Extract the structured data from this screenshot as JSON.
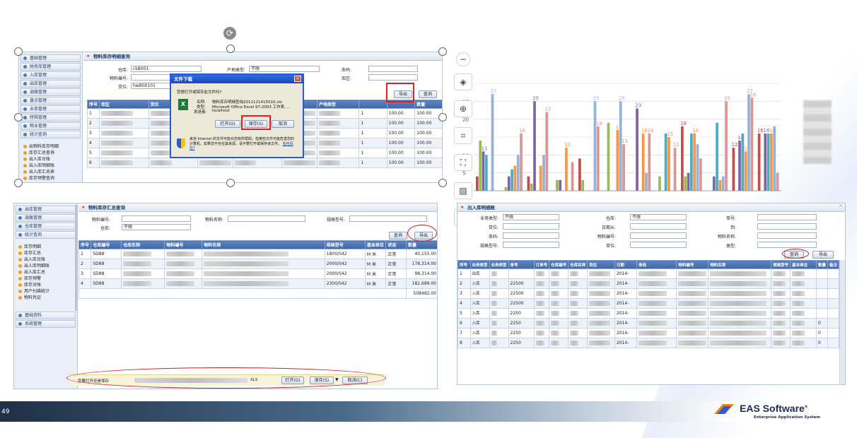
{
  "page_number": "49",
  "brand": {
    "name": "EAS Software",
    "reg": "®",
    "tagline": "Enterprise Application System"
  },
  "panel1": {
    "title": "物料库存明细查询",
    "menu": [
      "基础管理",
      "财务库管理",
      "入库管理",
      "出库管理",
      "调拨管理",
      "盘点管理",
      "业务管理",
      "特殊管理",
      "物业管理",
      "统计查询"
    ],
    "submenu": [
      "出物料库存明细",
      "库存汇总查询",
      "出入库台账",
      "出入库明细账",
      "出入库汇总表",
      "库存预警查询"
    ],
    "labels": {
      "warehouse": "仓库:",
      "material_no": "物料编号:",
      "location": "货位:",
      "product_type": "产地类型:",
      "barcode": "条码:",
      "zone": "库区:"
    },
    "values": {
      "warehouse": "ckB001",
      "location": "hwB00101",
      "product_type": "不限"
    },
    "btn_export": "导出",
    "btn_query": "查询",
    "columns": [
      "序号",
      "库区",
      "货位",
      "",
      "",
      "",
      "产地类型",
      "",
      "",
      "数量"
    ],
    "rows": [
      {
        "n": "1",
        "qty": "1",
        "amt": "100.00",
        "amt2": "100.00"
      },
      {
        "n": "2",
        "qty": "1",
        "amt": "100.00",
        "amt2": "100.00"
      },
      {
        "n": "3",
        "qty": "1",
        "amt": "100.00",
        "amt2": "100.00"
      },
      {
        "n": "4",
        "qty": "1",
        "amt": "100.00",
        "amt2": "100.00"
      },
      {
        "n": "5",
        "qty": "1",
        "amt": "100.00",
        "amt2": "100.00"
      },
      {
        "n": "6",
        "qty": "1",
        "amt": "100.00",
        "amt2": "100.00"
      }
    ],
    "cell_frag": "101"
  },
  "dialog": {
    "title": "文件下载",
    "question": "您想打开或保存此文件吗?",
    "name_label": "名称:",
    "name_value": "物料库存明细查询2011121415010.xls",
    "type_label": "类型:",
    "type_value": "Microsoft Office Excel 97-2003 工作表, ...",
    "from_label": "发送者:",
    "from_value": "localhost",
    "btn_open": "打开(O)",
    "btn_save": "保存(S)",
    "btn_cancel": "取消",
    "warning": "来自 Internet 的文件可能对您有所帮助，但某些文件可能危害您的计算机。如果您不信任其来源，请不要打开或保存该文件。",
    "risk_link": "有何风险?"
  },
  "panel2": {
    "title": "物料库存汇总查询",
    "menu_top": [
      "出库管理",
      "调拨管理",
      "仓库管理",
      "统计查询"
    ],
    "submenu": [
      "库存明细",
      "库存汇总",
      "出入库台账",
      "出入库明细账",
      "出入库汇总",
      "库存预警",
      "库存对账",
      "用户扫描统计",
      "物料凭证"
    ],
    "menu_bottom": [
      "基础资料",
      "系统管理"
    ],
    "labels": {
      "material_no": "物料编号:",
      "material_name": "物料名称:",
      "spec": "规格型号:",
      "warehouse": "仓库:"
    },
    "values": {
      "warehouse": "不限"
    },
    "btn_query": "查询",
    "btn_export": "导出",
    "columns": [
      "序号",
      "仓库编号",
      "仓库名称",
      "物料编号",
      "物料名称",
      "规格型号",
      "基本单位",
      "状态",
      "数量"
    ],
    "rows": [
      {
        "n": "1",
        "wh": "SD88",
        "spec": "1800/S42",
        "unit": "M 米",
        "status": "正常",
        "qty": "40,155.00"
      },
      {
        "n": "2",
        "wh": "SD88",
        "spec": "2000/S42",
        "unit": "M 米",
        "status": "正常",
        "qty": "178,314.00"
      },
      {
        "n": "3",
        "wh": "SD88",
        "spec": "2000/S42",
        "unit": "M 米",
        "status": "正常",
        "qty": "98,314.00"
      },
      {
        "n": "4",
        "wh": "SD88",
        "spec": "2300/S42",
        "unit": "M 米",
        "status": "正常",
        "qty": "182,689.00"
      }
    ],
    "total": "508482.00",
    "notify_text": "您要打开还是保存",
    "notify_frag": "XLS",
    "btn_open": "打开(O)",
    "btn_save": "保存(S)",
    "btn_cancel": "取消(C)"
  },
  "chart_data": {
    "type": "bar",
    "y_ticks": [
      "0",
      "5",
      "10",
      "15",
      "20",
      "25",
      "30"
    ],
    "ylim": [
      0,
      30
    ],
    "groups": [
      [
        4,
        14,
        11,
        10,
        0,
        27,
        0
      ],
      [
        0,
        1,
        4,
        6,
        7,
        10,
        16
      ],
      [
        4,
        2,
        25,
        0,
        7,
        10,
        22
      ],
      [
        0,
        3,
        3,
        0,
        12,
        0,
        8
      ],
      [
        9,
        3,
        0,
        0,
        0,
        25,
        18
      ],
      [
        0,
        19,
        0,
        0,
        17,
        25,
        13
      ],
      [
        0,
        0,
        23,
        0,
        16,
        5,
        16
      ],
      [
        0,
        4,
        0,
        16,
        15,
        0,
        12
      ],
      [
        18,
        4,
        5,
        16,
        16,
        13,
        9
      ],
      [
        0,
        0,
        4,
        19,
        3,
        4,
        25
      ],
      [
        12,
        0,
        14,
        16,
        11,
        27,
        26
      ],
      [
        16,
        0,
        16,
        16,
        16,
        18,
        5
      ]
    ],
    "labels_shown": [
      "27",
      "25",
      "25",
      "22",
      "25",
      "25",
      "23",
      "19",
      "18",
      "16",
      "18",
      "19",
      "16",
      "25",
      "27",
      "26",
      "16",
      "16",
      "12",
      "12",
      "14",
      "17",
      "15",
      "14",
      "13",
      "11",
      "11",
      "10",
      "8",
      "7",
      "5",
      "4",
      "4",
      "3",
      "1",
      "0",
      "0",
      "0",
      "0"
    ],
    "colors": [
      "#c0504d",
      "#9bbb59",
      "#8064a2",
      "#4bacc6",
      "#f79646",
      "#95b3d7",
      "#d99694"
    ]
  },
  "panel3": {
    "title": "出入库明细账",
    "labels": {
      "type": "业务类型:",
      "warehouse": "仓库:",
      "doc_no": "单号:",
      "location": "货位:",
      "date_from": "日期从:",
      "to": "到:",
      "barcode": "条码:",
      "material_no": "物料编号:",
      "material_name": "物料名称:",
      "spec": "规格型号:",
      "unit": "单位:",
      "category": "类型:"
    },
    "values": {
      "type": "不限",
      "warehouse": "不限"
    },
    "btn_query": "查询",
    "btn_export": "导出",
    "columns": [
      "序号",
      "业务类型",
      "业务类型",
      "单号",
      "订单号",
      "仓库编号",
      "仓库名称",
      "货位",
      "日期",
      "条码",
      "物料编号",
      "物料名称",
      "规格型号",
      "基本单位",
      "数量",
      "备注"
    ],
    "rows": [
      {
        "n": "1",
        "t": "出库",
        "d": "2014-"
      },
      {
        "n": "2",
        "t": "入库",
        "doc": "22500",
        "d": "2014-"
      },
      {
        "n": "3",
        "t": "入库",
        "doc": "22500",
        "d": "2014-"
      },
      {
        "n": "4",
        "t": "入库",
        "doc": "22500",
        "d": "2014-"
      },
      {
        "n": "5",
        "t": "入库",
        "doc": "2250",
        "d": "2014-"
      },
      {
        "n": "6",
        "t": "入库",
        "doc": "2250",
        "d": "2014-",
        "q": "0"
      },
      {
        "n": "7",
        "t": "入库",
        "doc": "2250",
        "d": "2014-",
        "q": "0"
      },
      {
        "n": "8",
        "t": "入库",
        "doc": "2250",
        "d": "2014-",
        "q": "0"
      }
    ]
  }
}
